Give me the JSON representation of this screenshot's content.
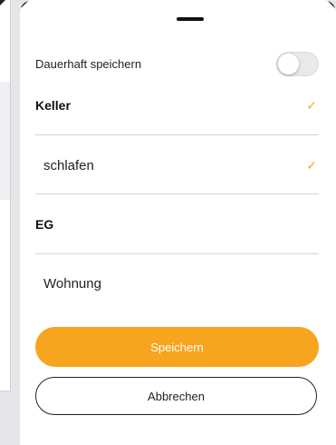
{
  "sheet": {
    "persist_label": "Dauerhaft speichern",
    "persist_toggle_on": false
  },
  "list": {
    "items": [
      {
        "label": "Keller",
        "style": "bold",
        "checked": true
      },
      {
        "label": "schlafen",
        "style": "normal",
        "checked": true
      },
      {
        "label": "EG",
        "style": "bold",
        "checked": false
      },
      {
        "label": "Wohnung",
        "style": "normal",
        "checked": false
      }
    ]
  },
  "buttons": {
    "save_label": "Speichern",
    "cancel_label": "Abbrechen"
  },
  "icons": {
    "check": "✓"
  },
  "colors": {
    "accent": "#f7a51e",
    "text": "#222222"
  }
}
